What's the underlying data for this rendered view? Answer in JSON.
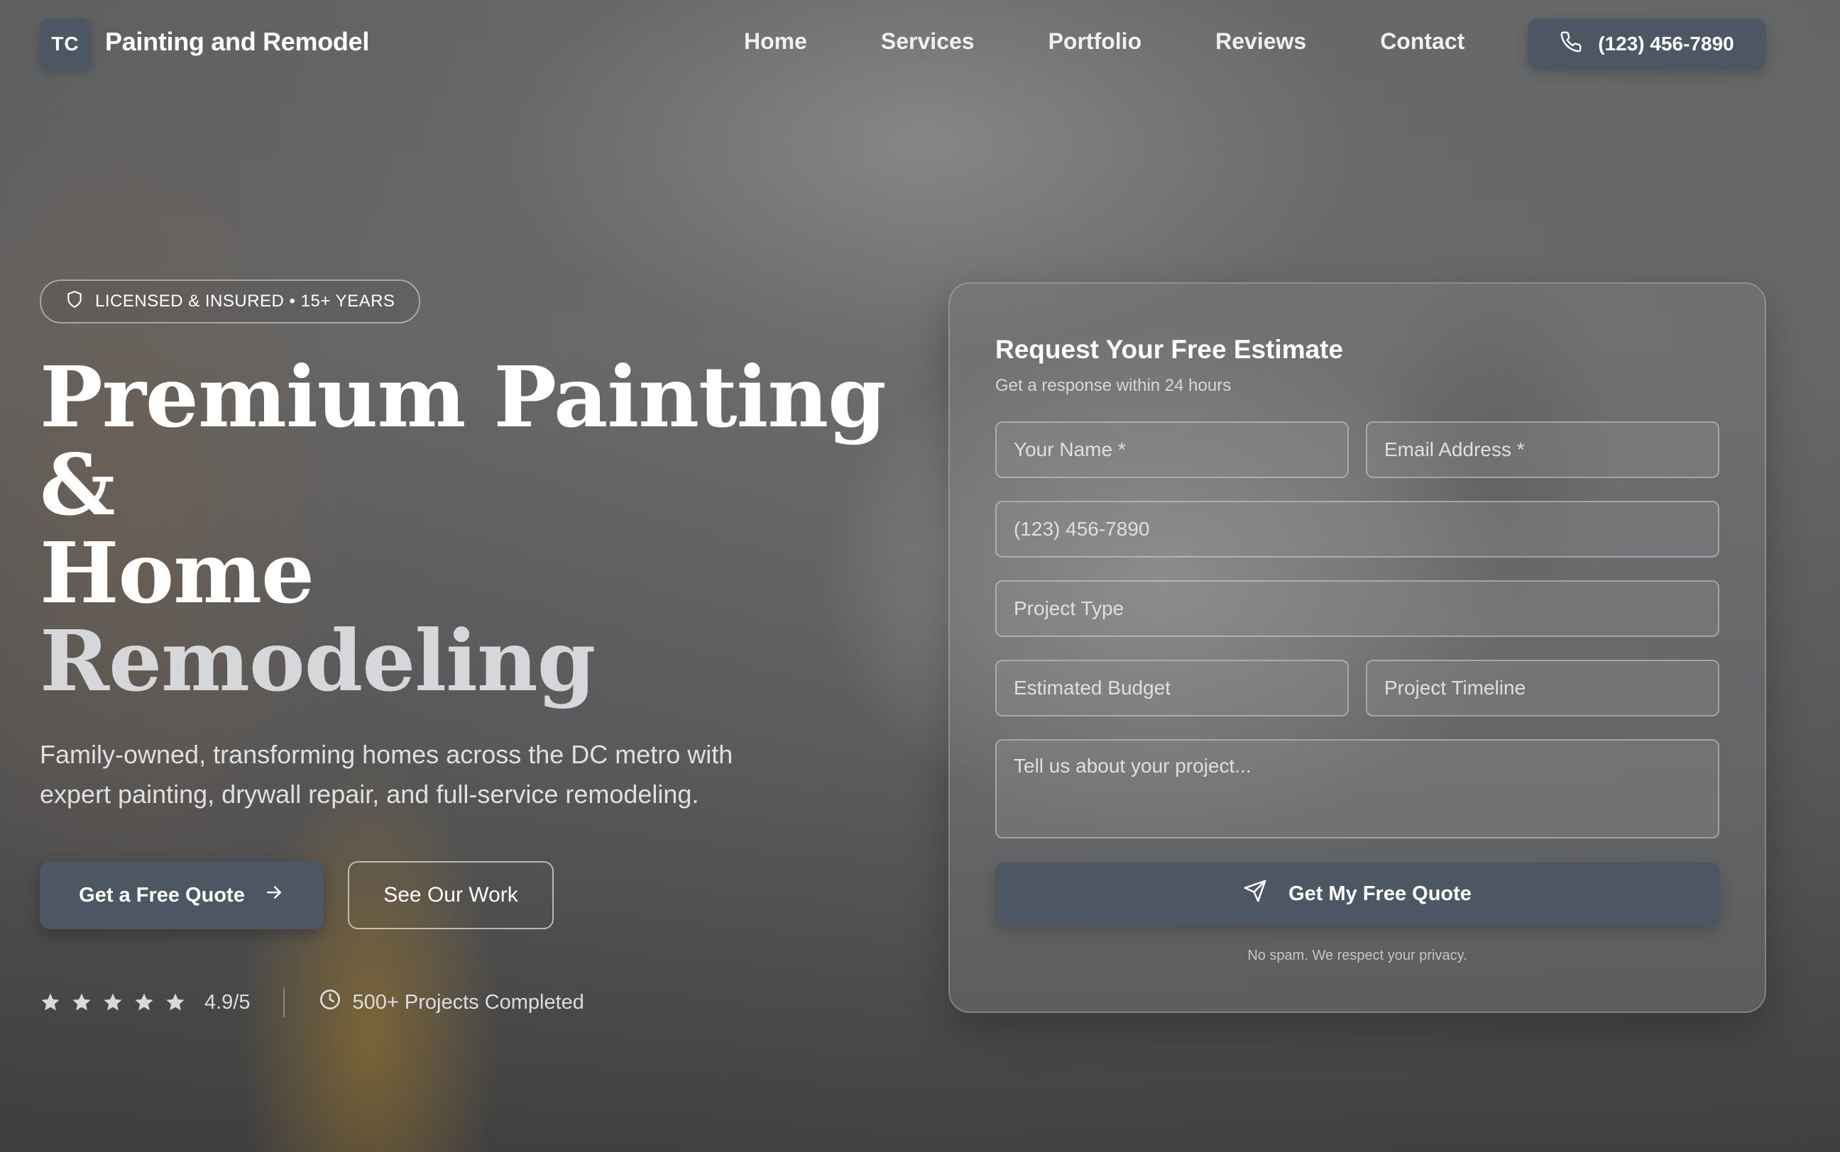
{
  "header": {
    "logo_initials": "TC",
    "brand_name": "Painting and Remodel",
    "nav": [
      {
        "label": "Home"
      },
      {
        "label": "Services"
      },
      {
        "label": "Portfolio"
      },
      {
        "label": "Reviews"
      },
      {
        "label": "Contact"
      }
    ],
    "phone": "(123) 456-7890"
  },
  "hero": {
    "badge": "LICENSED & INSURED • 15+ YEARS",
    "headline": {
      "line1": "Premium Painting",
      "line2": "&",
      "line3": "Home",
      "line4": "Remodeling"
    },
    "lede": "Family-owned, transforming homes across the DC metro with expert painting, drywall repair, and full-service remodeling.",
    "primary_cta": "Get a Free Quote",
    "secondary_cta": "See Our Work",
    "rating": {
      "stars": 5,
      "text": "4.9/5"
    },
    "projects": "500+ Projects Completed"
  },
  "form": {
    "title": "Request Your Free Estimate",
    "subtitle": "Get a response within 24 hours",
    "fields": {
      "name": "Your Name *",
      "email": "Email Address *",
      "phone": "(123) 456-7890",
      "project_type": "Project Type",
      "budget": "Estimated Budget",
      "timeline": "Project Timeline",
      "message": "Tell us about your project..."
    },
    "submit": "Get My Free Quote",
    "privacy": "No spam. We respect your privacy."
  },
  "colors": {
    "button_bg": "#4d5663",
    "text": "#ffffff",
    "muted_text": "#dcdde0"
  },
  "icons": [
    "phone-icon",
    "shield-icon",
    "arrow-right-icon",
    "star-icon",
    "clock-icon",
    "send-icon"
  ]
}
